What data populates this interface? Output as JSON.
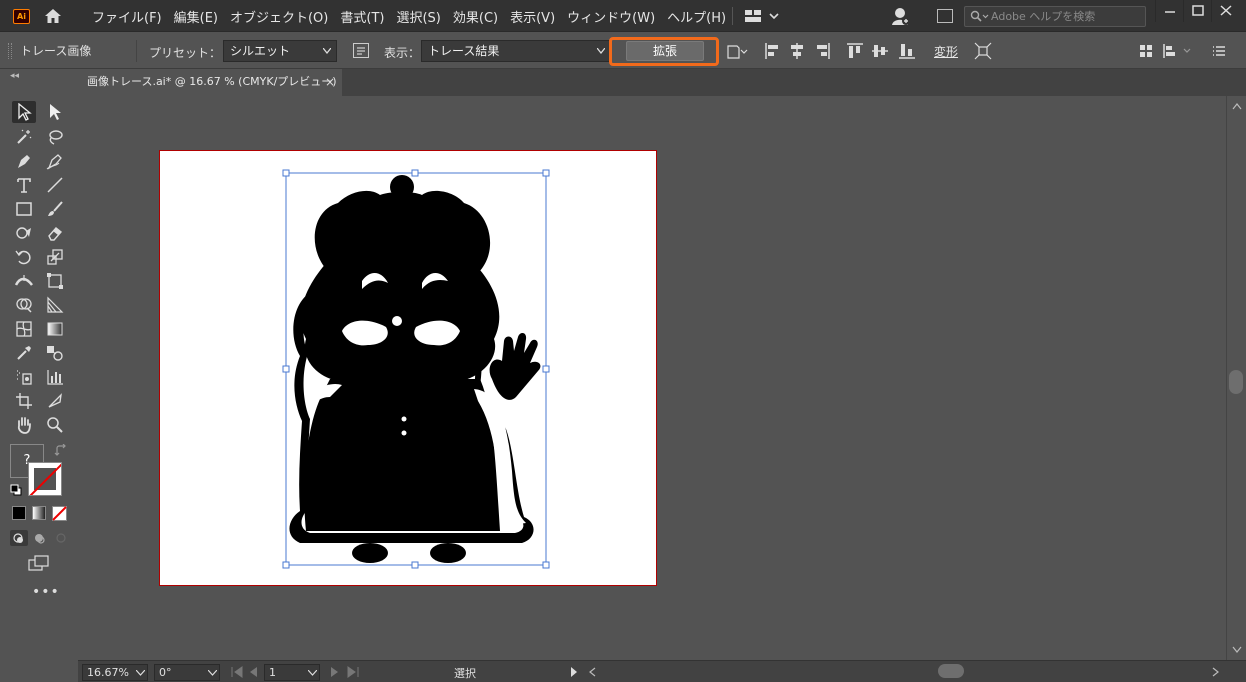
{
  "app": {
    "logo_text": "Ai"
  },
  "menu": {
    "items": [
      "ファイル(F)",
      "編集(E)",
      "オブジェクト(O)",
      "書式(T)",
      "選択(S)",
      "効果(C)",
      "表示(V)",
      "ウィンドウ(W)",
      "ヘルプ(H)"
    ]
  },
  "search": {
    "placeholder": "Adobe ヘルプを検索"
  },
  "control_bar": {
    "title": "トレース画像",
    "preset_label": "プリセット：",
    "preset_value": "シルエット",
    "view_label": "表示：",
    "view_value": "トレース結果",
    "expand_label": "拡張",
    "transform_label": "変形"
  },
  "document": {
    "tab_label": "画像トレース.ai* @ 16.67 % (CMYK/プレビュー)",
    "close_glyph": "×"
  },
  "toolbar": {
    "unknown_fill_glyph": "?"
  },
  "status": {
    "zoom": "16.67%",
    "rotation": "0°",
    "artboard_number": "1",
    "tool_status": "選択"
  },
  "colors": {
    "accent_highlight": "#f26a1b",
    "selection_blue": "#4a78d0",
    "artboard_border": "#b00000"
  }
}
